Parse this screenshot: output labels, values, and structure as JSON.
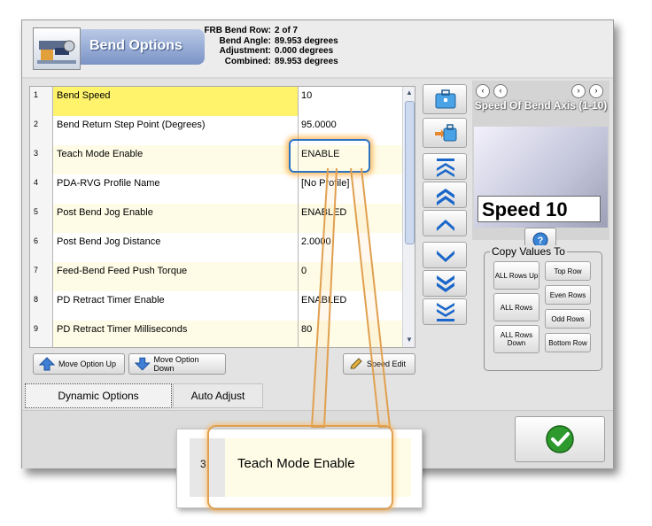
{
  "header": {
    "title": "Bend Options",
    "info_labels": [
      "FRB Bend Row:",
      "Bend Angle:",
      "Adjustment:",
      "Combined:"
    ],
    "info_values": [
      "2 of 7",
      "89.953 degrees",
      "0.000 degrees",
      "89.953 degrees"
    ]
  },
  "grid": {
    "rows": [
      {
        "num": "1",
        "name": "Bend Speed",
        "value": "10"
      },
      {
        "num": "2",
        "name": "Bend Return Step Point (Degrees)",
        "value": "95.0000"
      },
      {
        "num": "3",
        "name": "Teach Mode Enable",
        "value": "ENABLE"
      },
      {
        "num": "4",
        "name": "PDA-RVG Profile Name",
        "value": "[No Profile]"
      },
      {
        "num": "5",
        "name": "Post Bend Jog Enable",
        "value": "ENABLED"
      },
      {
        "num": "6",
        "name": "Post Bend Jog Distance",
        "value": "2.0000"
      },
      {
        "num": "7",
        "name": "Feed-Bend Feed Push Torque",
        "value": "0"
      },
      {
        "num": "8",
        "name": "PD Retract Timer Enable",
        "value": "ENABLED"
      },
      {
        "num": "9",
        "name": "PD Retract Timer Milliseconds",
        "value": "80"
      }
    ]
  },
  "buttons": {
    "move_up": "Move Option Up",
    "move_down": "Move Option Down",
    "speed_edit": "Speed Edit"
  },
  "tabs": [
    "Dynamic Options",
    "Auto Adjust"
  ],
  "speed": {
    "title": "Speed Of Bend Axis (1-10)",
    "value": "Speed 10"
  },
  "copy": {
    "legend": "Copy Values To",
    "all_rows_up": "ALL Rows Up",
    "all_rows": "ALL Rows",
    "all_rows_down": "ALL Rows Down",
    "top_row": "Top Row",
    "even_rows": "Even Rows",
    "odd_rows": "Odd Rows",
    "bottom_row": "Bottom Row"
  },
  "zoom": {
    "num": "3",
    "name": "Teach Mode Enable"
  },
  "colors": {
    "selected_row": "#fff36c",
    "highlight_blue": "#2b74c4",
    "callout_orange": "#e0a050",
    "ok_green": "#2e9a2e"
  }
}
